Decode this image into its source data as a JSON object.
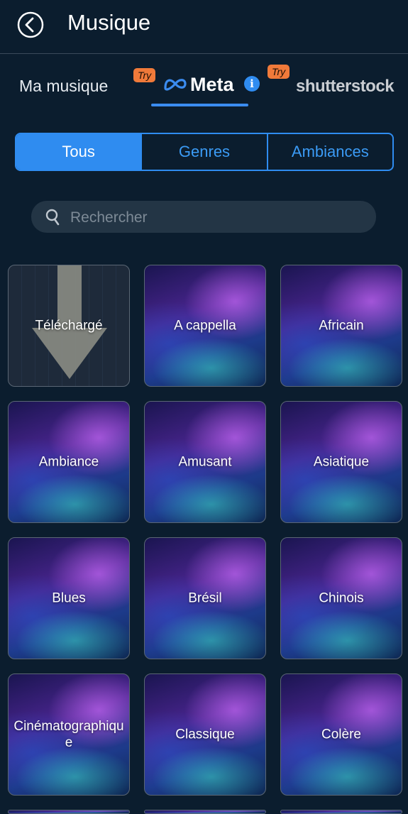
{
  "header": {
    "title": "Musique"
  },
  "source_tabs": {
    "my_music": "Ma musique",
    "try_badge_1": "Try",
    "meta": "Meta",
    "try_badge_2": "Try",
    "shutterstock": "shutterstock"
  },
  "segments": [
    "Tous",
    "Genres",
    "Ambiances"
  ],
  "search": {
    "placeholder": "Rechercher"
  },
  "tiles": [
    "Téléchargé",
    "A cappella",
    "Africain",
    "Ambiance",
    "Amusant",
    "Asiatique",
    "Blues",
    "Brésil",
    "Chinois",
    "Cinématographique",
    "Classique",
    "Colère"
  ],
  "colors": {
    "background": "#0b1d2e",
    "accent": "#2f8cf0",
    "try_badge": "#f07a3a"
  }
}
